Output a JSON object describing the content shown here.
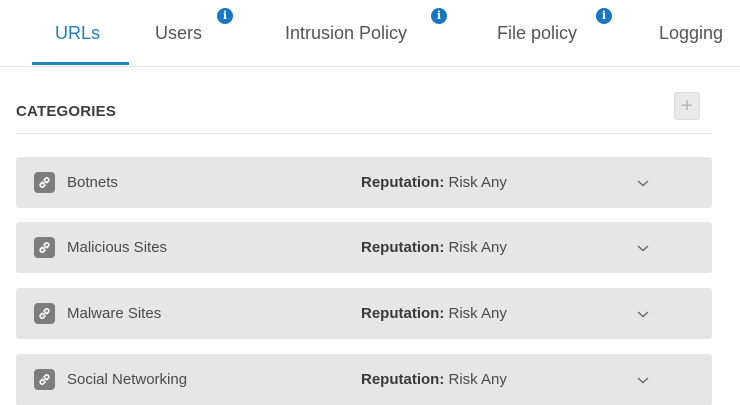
{
  "tabs": [
    {
      "label": "URLs",
      "active": true,
      "info": false
    },
    {
      "label": "Users",
      "active": false,
      "info": true
    },
    {
      "label": "Intrusion Policy",
      "active": false,
      "info": true
    },
    {
      "label": "File policy",
      "active": false,
      "info": true
    },
    {
      "label": "Logging",
      "active": false,
      "info": false
    }
  ],
  "info_badge_glyph": "i",
  "section": {
    "title": "CATEGORIES",
    "add_label": "+"
  },
  "categories": [
    {
      "name": "Botnets",
      "reputation_label": "Reputation:",
      "reputation_value": "Risk Any",
      "icon": "link-icon"
    },
    {
      "name": "Malicious Sites",
      "reputation_label": "Reputation:",
      "reputation_value": "Risk Any",
      "icon": "link-icon"
    },
    {
      "name": "Malware Sites",
      "reputation_label": "Reputation:",
      "reputation_value": "Risk Any",
      "icon": "link-icon"
    },
    {
      "name": "Social Networking",
      "reputation_label": "Reputation:",
      "reputation_value": "Risk Any",
      "icon": "link-icon"
    }
  ],
  "colors": {
    "accent": "#1f7dbf",
    "info_badge": "#1877c4",
    "row_background": "#e6e6e6"
  }
}
